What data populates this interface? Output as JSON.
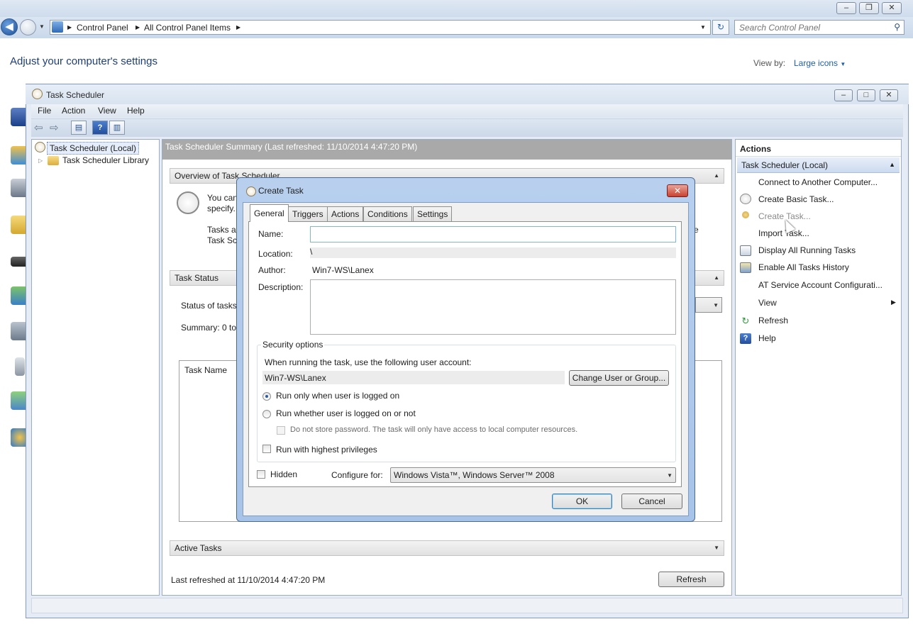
{
  "control_panel": {
    "address": {
      "crumbs": [
        "Control Panel",
        "All Control Panel Items"
      ]
    },
    "search": {
      "placeholder": "Search Control Panel"
    },
    "heading": "Adjust your computer's settings",
    "view_by_label": "View by:",
    "view_by_value": "Large icons"
  },
  "task_scheduler": {
    "title": "Task Scheduler",
    "menu": [
      "File",
      "Action",
      "View",
      "Help"
    ],
    "tree": {
      "root": "Task Scheduler (Local)",
      "child": "Task Scheduler Library"
    },
    "center": {
      "header": "Task Scheduler Summary (Last refreshed: 11/10/2014 4:47:20 PM)",
      "overview_title": "Overview of Task Scheduler",
      "overview_text_1": "You can",
      "overview_text_2": "specify.",
      "overview_text_3": "Tasks ar",
      "overview_text_4": "Task Sch",
      "overview_text_right": "e",
      "task_status_title": "Task Status",
      "status_of_tasks": "Status of tasks",
      "summary": "Summary: 0 tot",
      "table_header": "Task Name",
      "active_tasks_title": "Active Tasks",
      "last_refreshed": "Last refreshed at 11/10/2014 4:47:20 PM",
      "refresh_button": "Refresh"
    },
    "actions": {
      "header": "Actions",
      "group": "Task Scheduler (Local)",
      "items": [
        "Connect to Another Computer...",
        "Create Basic Task...",
        "Create Task...",
        "Import Task...",
        "Display All Running Tasks",
        "Enable All Tasks History",
        "AT Service Account Configurati...",
        "View",
        "Refresh",
        "Help"
      ]
    }
  },
  "create_task": {
    "title": "Create Task",
    "tabs": [
      "General",
      "Triggers",
      "Actions",
      "Conditions",
      "Settings"
    ],
    "active_tab": "General",
    "name_label": "Name:",
    "name_value": "",
    "location_label": "Location:",
    "location_value": "\\",
    "author_label": "Author:",
    "author_value": "Win7-WS\\Lanex",
    "description_label": "Description:",
    "description_value": "",
    "security": {
      "legend": "Security options",
      "account_prompt": "When running the task, use the following user account:",
      "account_value": "Win7-WS\\Lanex",
      "change_button": "Change User or Group...",
      "radio_logged_on": "Run only when user is logged on",
      "radio_whether": "Run whether user is logged on or not",
      "do_not_store": "Do not store password.  The task will only have access to local computer resources.",
      "highest_privileges": "Run with highest privileges"
    },
    "hidden_label": "Hidden",
    "configure_label": "Configure for:",
    "configure_value": "Windows Vista™, Windows Server™ 2008",
    "ok_button": "OK",
    "cancel_button": "Cancel"
  },
  "colors": {
    "accent": "#1e5fa8",
    "dialog_frame": "#a7c3e8",
    "close_red": "#c9412f"
  }
}
